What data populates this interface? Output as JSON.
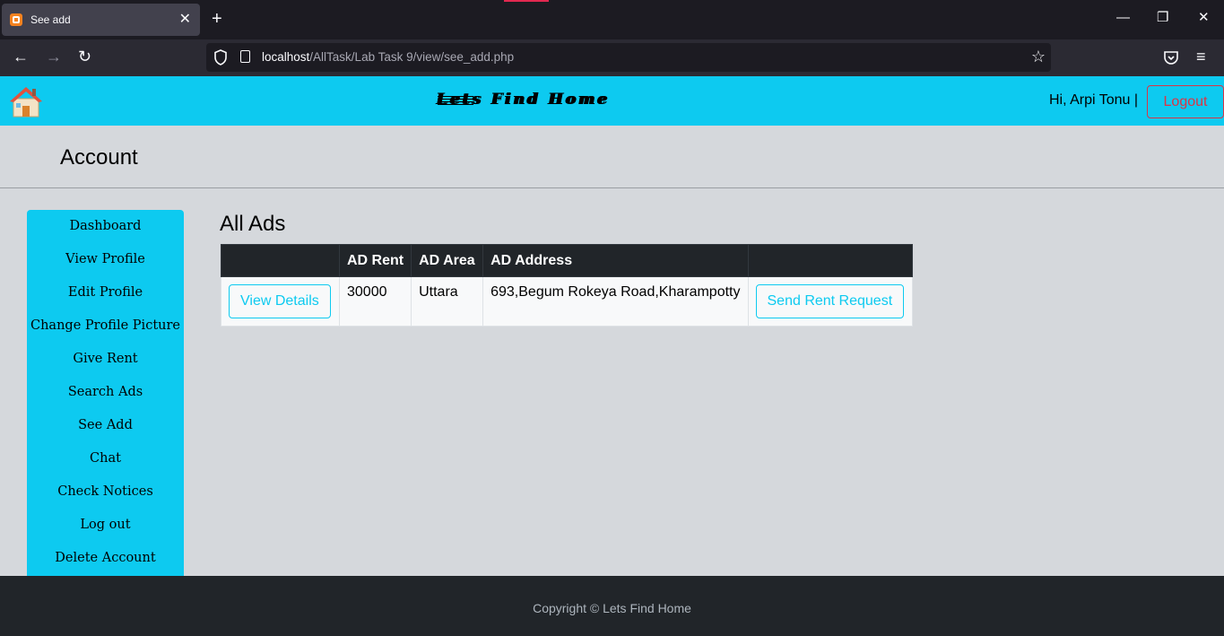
{
  "browser": {
    "tab_title": "See add",
    "url_host": "localhost",
    "url_path": "/AllTask/Lab Task 9/view/see_add.php"
  },
  "header": {
    "brand": "Lets Find Home",
    "greeting": "Hi, Arpi Tonu  |",
    "logout_label": "Logout"
  },
  "account_title": "Account",
  "sidebar": {
    "items": [
      {
        "label": "Dashboard"
      },
      {
        "label": "View Profile"
      },
      {
        "label": "Edit Profile"
      },
      {
        "label": "Change Profile Picture"
      },
      {
        "label": "Give Rent"
      },
      {
        "label": "Search Ads"
      },
      {
        "label": "See Add"
      },
      {
        "label": "Chat"
      },
      {
        "label": "Check Notices"
      },
      {
        "label": "Log out"
      },
      {
        "label": "Delete Account"
      }
    ]
  },
  "main": {
    "title": "All Ads",
    "columns": [
      "",
      "AD Rent",
      "AD Area",
      "AD Address",
      ""
    ],
    "rows": [
      {
        "details_label": "View Details",
        "rent": "30000",
        "area": "Uttara",
        "address": "693,Begum Rokeya Road,Kharampotty",
        "request_label": "Send Rent Request"
      }
    ]
  },
  "footer": {
    "text": "Copyright © Lets Find Home"
  },
  "colors": {
    "accent": "#0dcaf0",
    "danger": "#dc3545",
    "dark": "#212529",
    "page_bg": "#d5d8dc"
  }
}
